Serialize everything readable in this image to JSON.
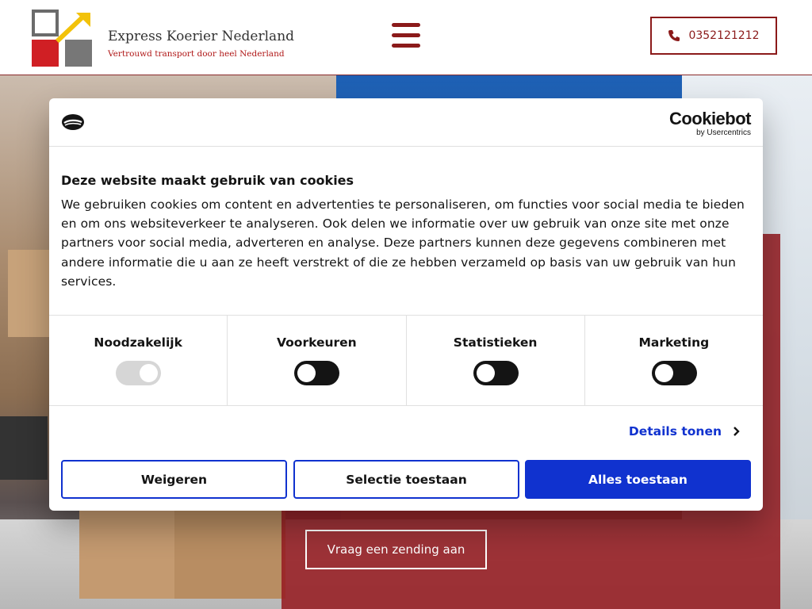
{
  "header": {
    "brand_name": "Express Koerier Nederland",
    "brand_tagline": "Vertrouwd transport door heel Nederland",
    "phone": "0352121212",
    "logo_icon": "four-squares-arrow-logo",
    "menu_icon": "hamburger-icon",
    "phone_icon": "phone-icon"
  },
  "hero": {
    "cta_label": "Vraag een zending aan"
  },
  "cookie_dialog": {
    "provider_name": "Cookiebot",
    "provider_sub": "by Usercentrics",
    "title": "Deze website maakt gebruik van cookies",
    "body": "We gebruiken cookies om content en advertenties te personaliseren, om functies voor social media te bieden en om ons websiteverkeer te analyseren. Ook delen we informatie over uw gebruik van onze site met onze partners voor social media, adverteren en analyse. Deze partners kunnen deze gegevens combineren met andere informatie die u aan ze heeft verstrekt of die ze hebben verzameld op basis van uw gebruik van hun services.",
    "categories": [
      {
        "label": "Noodzakelijk",
        "state": "on",
        "disabled": true
      },
      {
        "label": "Voorkeuren",
        "state": "off",
        "disabled": false
      },
      {
        "label": "Statistieken",
        "state": "off",
        "disabled": false
      },
      {
        "label": "Marketing",
        "state": "off",
        "disabled": false
      }
    ],
    "details_label": "Details tonen",
    "buttons": {
      "deny": "Weigeren",
      "allow_selection": "Selectie toestaan",
      "allow_all": "Alles toestaan"
    }
  },
  "colors": {
    "brand_red": "#8b1a1a",
    "cookiebot_blue": "#1032cf",
    "toggle_off": "#141414",
    "toggle_disabled": "#d6d6d6"
  }
}
